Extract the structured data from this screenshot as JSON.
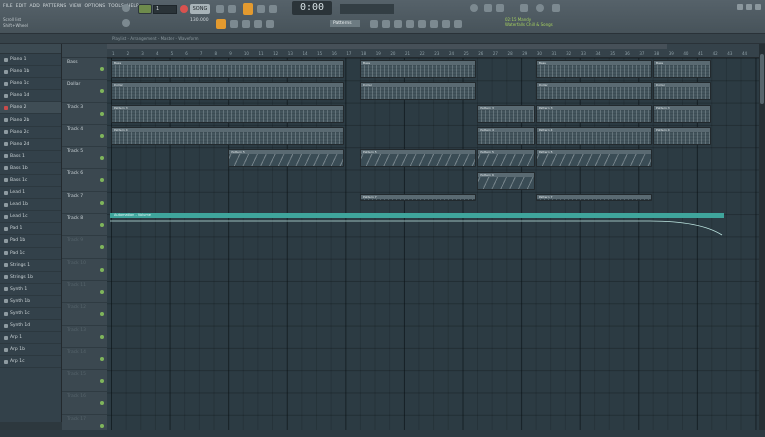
{
  "menu": [
    "FILE",
    "EDIT",
    "ADD",
    "PATTERNS",
    "VIEW",
    "OPTIONS",
    "TOOLS",
    "HELP"
  ],
  "hint": {
    "line1": "Scroll list",
    "line2": "Shift+Wheel"
  },
  "toolbar": {
    "pattern_selector": "1",
    "song_label": "SONG",
    "tempo": "130.000",
    "time_display": "0:00",
    "time_sub": "M:S:CS",
    "snap_label": "Patterns",
    "tip_line1": "02:15  Mandy",
    "tip_line2": "Waterfalls Chill & Songs"
  },
  "breadcrumb": "Playlist - Arrangement - Master - Waveform",
  "browser": {
    "items": [
      {
        "label": "Piano 1"
      },
      {
        "label": "Piano 1b"
      },
      {
        "label": "Piano 1c"
      },
      {
        "label": "Piano 1d"
      },
      {
        "label": "Piano 2",
        "selected": true
      },
      {
        "label": "Piano 2b"
      },
      {
        "label": "Piano 2c"
      },
      {
        "label": "Piano 2d"
      },
      {
        "label": "Bass 1"
      },
      {
        "label": "Bass 1b"
      },
      {
        "label": "Bass 1c"
      },
      {
        "label": "Lead 1"
      },
      {
        "label": "Lead 1b"
      },
      {
        "label": "Lead 1c"
      },
      {
        "label": "Pad 1"
      },
      {
        "label": "Pad 1b"
      },
      {
        "label": "Pad 1c"
      },
      {
        "label": "Strings 1"
      },
      {
        "label": "Strings 1b"
      },
      {
        "label": "Synth 1"
      },
      {
        "label": "Synth 1b"
      },
      {
        "label": "Synth 1c"
      },
      {
        "label": "Synth 1d"
      },
      {
        "label": "Arp 1"
      },
      {
        "label": "Arp 1b"
      },
      {
        "label": "Arp 1c"
      }
    ]
  },
  "tracks": [
    {
      "label": "Bass"
    },
    {
      "label": "Dollar"
    },
    {
      "label": "Track 3"
    },
    {
      "label": "Track 4"
    },
    {
      "label": "Track 5"
    },
    {
      "label": "Track 6"
    },
    {
      "label": "Track 7"
    },
    {
      "label": "Track 8"
    },
    {
      "label": "Track 9",
      "dim": true
    },
    {
      "label": "Track 10",
      "dim": true
    },
    {
      "label": "Track 11",
      "dim": true
    },
    {
      "label": "Track 12",
      "dim": true
    },
    {
      "label": "Track 13",
      "dim": true
    },
    {
      "label": "Track 14",
      "dim": true
    },
    {
      "label": "Track 15",
      "dim": true
    },
    {
      "label": "Track 16",
      "dim": true
    },
    {
      "label": "Track 17",
      "dim": true
    }
  ],
  "ruler": {
    "bars": [
      "1",
      "2",
      "3",
      "4",
      "5",
      "6",
      "7",
      "8",
      "9",
      "10",
      "11",
      "12",
      "13",
      "14",
      "15",
      "16",
      "17",
      "18",
      "19",
      "20",
      "21",
      "22",
      "23",
      "24",
      "25",
      "26",
      "27",
      "28",
      "29",
      "30",
      "31",
      "32",
      "33",
      "34",
      "35",
      "36",
      "37",
      "38",
      "39",
      "40",
      "41",
      "42",
      "43",
      "44"
    ]
  },
  "clips": [
    {
      "track": 0,
      "start": 0,
      "len": 16,
      "label": "Bass"
    },
    {
      "track": 0,
      "start": 17,
      "len": 8,
      "label": "Bass"
    },
    {
      "track": 0,
      "start": 29,
      "len": 8,
      "label": "Bass"
    },
    {
      "track": 0,
      "start": 37,
      "len": 4,
      "label": "Bass"
    },
    {
      "track": 1,
      "start": 0,
      "len": 16,
      "label": "Dollar"
    },
    {
      "track": 1,
      "start": 17,
      "len": 8,
      "label": "Dollar"
    },
    {
      "track": 1,
      "start": 29,
      "len": 8,
      "label": "Dollar"
    },
    {
      "track": 1,
      "start": 37,
      "len": 4,
      "label": "Dollar"
    },
    {
      "track": 2,
      "start": 0,
      "len": 16,
      "label": "Pattern 3"
    },
    {
      "track": 2,
      "start": 25,
      "len": 4,
      "label": "Pattern 3"
    },
    {
      "track": 2,
      "start": 29,
      "len": 8,
      "label": "Pattern 3"
    },
    {
      "track": 2,
      "start": 37,
      "len": 4,
      "label": "Pattern 3"
    },
    {
      "track": 3,
      "start": 0,
      "len": 16,
      "label": "Pattern 4"
    },
    {
      "track": 3,
      "start": 25,
      "len": 4,
      "label": "Pattern 4"
    },
    {
      "track": 3,
      "start": 29,
      "len": 8,
      "label": "Pattern 4"
    },
    {
      "track": 3,
      "start": 37,
      "len": 4,
      "label": "Pattern 4"
    },
    {
      "track": 4,
      "start": 8,
      "len": 8,
      "label": "Pattern 5",
      "wave": true
    },
    {
      "track": 4,
      "start": 17,
      "len": 8,
      "label": "Pattern 5",
      "wave": true
    },
    {
      "track": 4,
      "start": 25,
      "len": 4,
      "label": "Pattern 5",
      "wave": true
    },
    {
      "track": 4,
      "start": 29,
      "len": 8,
      "label": "Pattern 5",
      "wave": true
    },
    {
      "track": 5,
      "start": 25,
      "len": 4,
      "label": "Pattern 6",
      "wave": true
    },
    {
      "track": 6,
      "start": 17,
      "len": 8,
      "label": "Pattern 7",
      "dark": true
    },
    {
      "track": 6,
      "start": 29,
      "len": 8,
      "label": "Pattern 7",
      "dark": true
    }
  ],
  "automation": {
    "label": "Automation - Volume"
  }
}
